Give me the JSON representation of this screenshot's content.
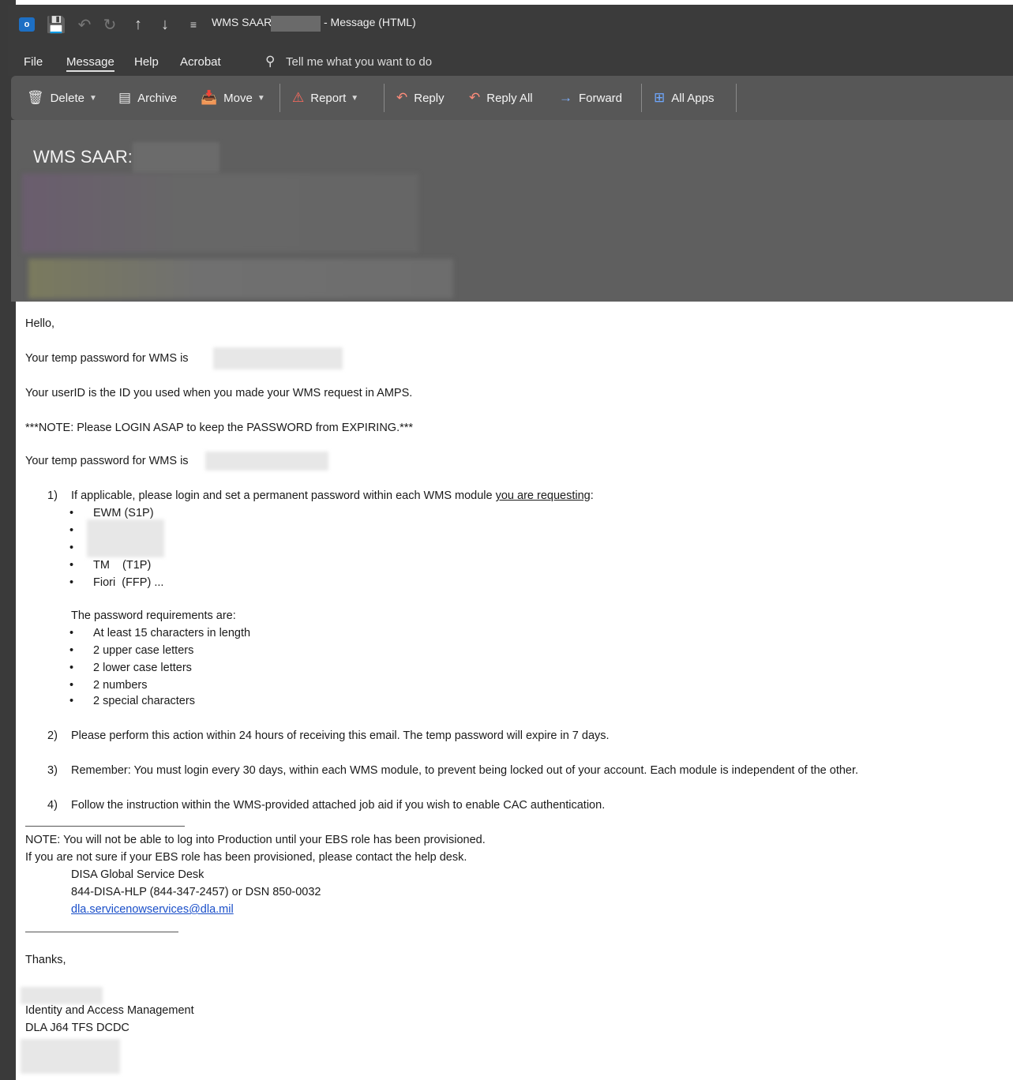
{
  "window": {
    "title": "WMS SAAR:",
    "title_suffix": "- Message (HTML)"
  },
  "menu": {
    "items": [
      "File",
      "Message",
      "Help",
      "Acrobat"
    ],
    "tell_me": "Tell me what you want to do"
  },
  "ribbon": {
    "delete": "Delete",
    "archive": "Archive",
    "move": "Move",
    "report": "Report",
    "reply": "Reply",
    "reply_all": "Reply All",
    "forward": "Forward",
    "all_apps": "All Apps"
  },
  "header": {
    "subject": "WMS SAAR:"
  },
  "email": {
    "greeting": "Hello,",
    "temp_pw_1": "Your temp password for WMS is",
    "userid": "Your userID is the ID you used when you made your WMS request in AMPS.",
    "note_login": "***NOTE: Please LOGIN ASAP to keep the PASSWORD from EXPIRING.***",
    "temp_pw_2": "Your temp password for WMS is",
    "step1_num": "1)",
    "step1_text": "If applicable, please login and set a permanent password within each WMS module",
    "step1_link": "you are requesting",
    "step1_colon": ":",
    "modules": [
      "EWM (S1P)",
      "",
      "",
      "TM    (T1P)",
      "Fiori  (FFP) ..."
    ],
    "pw_req_title": "The password requirements are:",
    "pw_reqs": [
      "At least 15 characters in length",
      "2 upper case letters",
      "2 lower case letters",
      "2 numbers",
      "2 special characters"
    ],
    "step2_num": "2)",
    "step2_text": "Please perform this action within 24 hours of receiving this email.  The temp password will expire in 7 days.",
    "step3_num": "3)",
    "step3_text": "Remember: You must login every 30 days, within each WMS module, to prevent being locked out of your account.  Each module is independent of the other.",
    "step4_num": "4)",
    "step4_text": "Follow the instruction within the WMS-provided attached job aid if you wish to enable CAC authentication.",
    "note_prod": "NOTE: You will not be able to log into Production until your EBS role has been provisioned.",
    "note_help": "If you are not sure if your EBS role has been provisioned, please contact the help desk.",
    "desk_name": "DISA Global Service Desk",
    "desk_phone": "844-DISA-HLP (844-347-2457) or DSN 850-0032",
    "desk_email": "dla.servicenowservices@dla.mil",
    "thanks": "Thanks,",
    "sig_dept": "Identity and Access Management",
    "sig_org": "DLA J64 TFS DCDC",
    "bullet": "•"
  }
}
